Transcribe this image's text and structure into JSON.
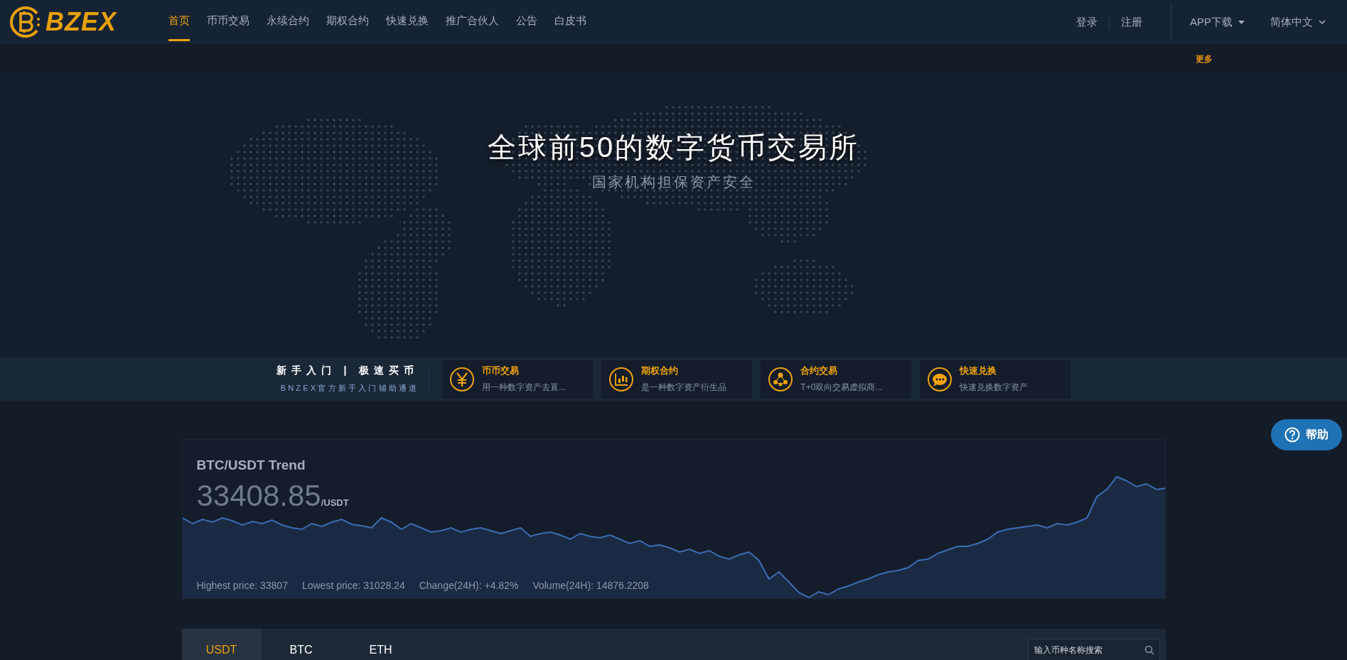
{
  "logo": {
    "text": "BZEX"
  },
  "nav": [
    {
      "label": "首页",
      "selected": true
    },
    {
      "label": "币币交易",
      "selected": false
    },
    {
      "label": "永续合约",
      "selected": false
    },
    {
      "label": "期权合约",
      "selected": false
    },
    {
      "label": "快速兑换",
      "selected": false
    },
    {
      "label": "推广合伙人",
      "selected": false
    },
    {
      "label": "公告",
      "selected": false
    },
    {
      "label": "白皮书",
      "selected": false
    }
  ],
  "account": [
    "登录",
    "注册"
  ],
  "app_download": "APP下载",
  "language": "简体中文",
  "more_link": "更多",
  "hero": {
    "title": "全球前50的数字货币交易所",
    "subtitle": "国家机构担保资产安全"
  },
  "guide": {
    "title": "新手入门 | 极速买币",
    "subtitle": "BNZEX官方新手入门辅助通道"
  },
  "features": [
    {
      "kind": "yen",
      "title": "币币交易",
      "desc": "用一种数字资产去直..."
    },
    {
      "kind": "candles",
      "title": "期权合约",
      "desc": "是一种数字资产衍生品"
    },
    {
      "kind": "network",
      "title": "合约交易",
      "desc": "T+0双向交易虚拟商..."
    },
    {
      "kind": "chat",
      "title": "快速兑换",
      "desc": "快速兑换数字资产"
    }
  ],
  "help_button": "帮助",
  "trend": {
    "title": "BTC/USDT Trend",
    "price": "33408.85",
    "unit": "/USDT",
    "stats": [
      "Highest price: 33807",
      "Lowest price: 31028.24",
      "Change(24H): +4.82%",
      "Volume(24H): 14876.2208"
    ]
  },
  "market_tabs": [
    {
      "label": "USDT",
      "selected": true
    },
    {
      "label": "BTC",
      "selected": false
    },
    {
      "label": "ETH",
      "selected": false
    }
  ],
  "search": {
    "placeholder": "输入币种名称搜索"
  }
}
